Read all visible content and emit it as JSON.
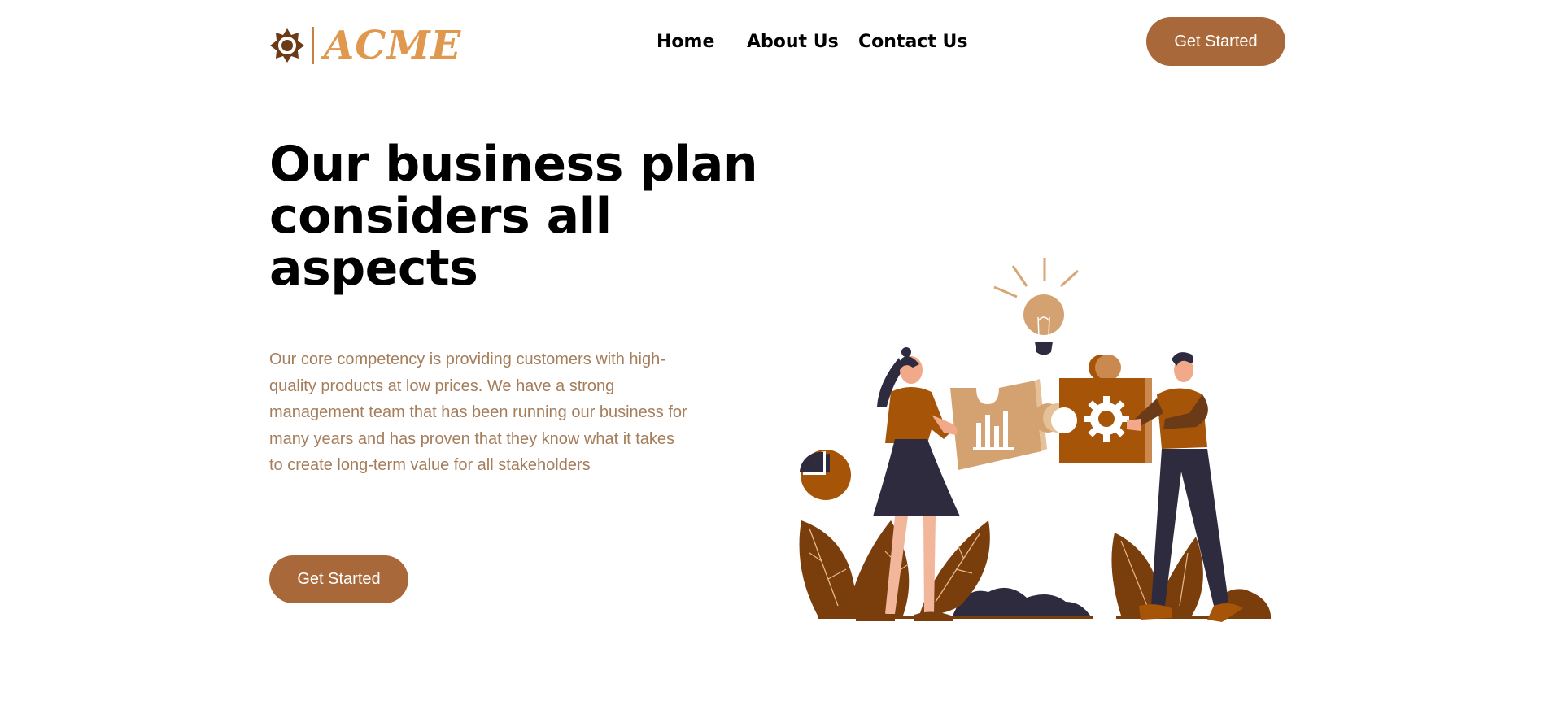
{
  "brand": {
    "name": "ACME",
    "logo_icon": "sun-gear-icon",
    "colors": {
      "logo_text": "#e0984f",
      "logo_mark": "#6b3a17",
      "divider": "#c97f3e"
    }
  },
  "nav": {
    "items": [
      {
        "label": "Home"
      },
      {
        "label": "About Us"
      },
      {
        "label": "Contact Us"
      }
    ]
  },
  "header": {
    "cta_label": "Get Started"
  },
  "hero": {
    "title": "Our business plan considers all aspects",
    "body": "Our core competency is providing customers with high-quality products at low prices. We have a strong management team that has been running our business for many years and has proven that they know what it takes to create long-term value for all stakeholders",
    "cta_label": "Get Started"
  },
  "illustration": {
    "subject": "two people joining puzzle pieces",
    "icons": [
      "lightbulb-icon",
      "bar-chart-icon",
      "gear-icon",
      "pie-chart-icon"
    ]
  },
  "theme": {
    "accent": "#a9683a",
    "body_text": "#a57d5a",
    "heading_text": "#000000",
    "background": "#ffffff"
  }
}
